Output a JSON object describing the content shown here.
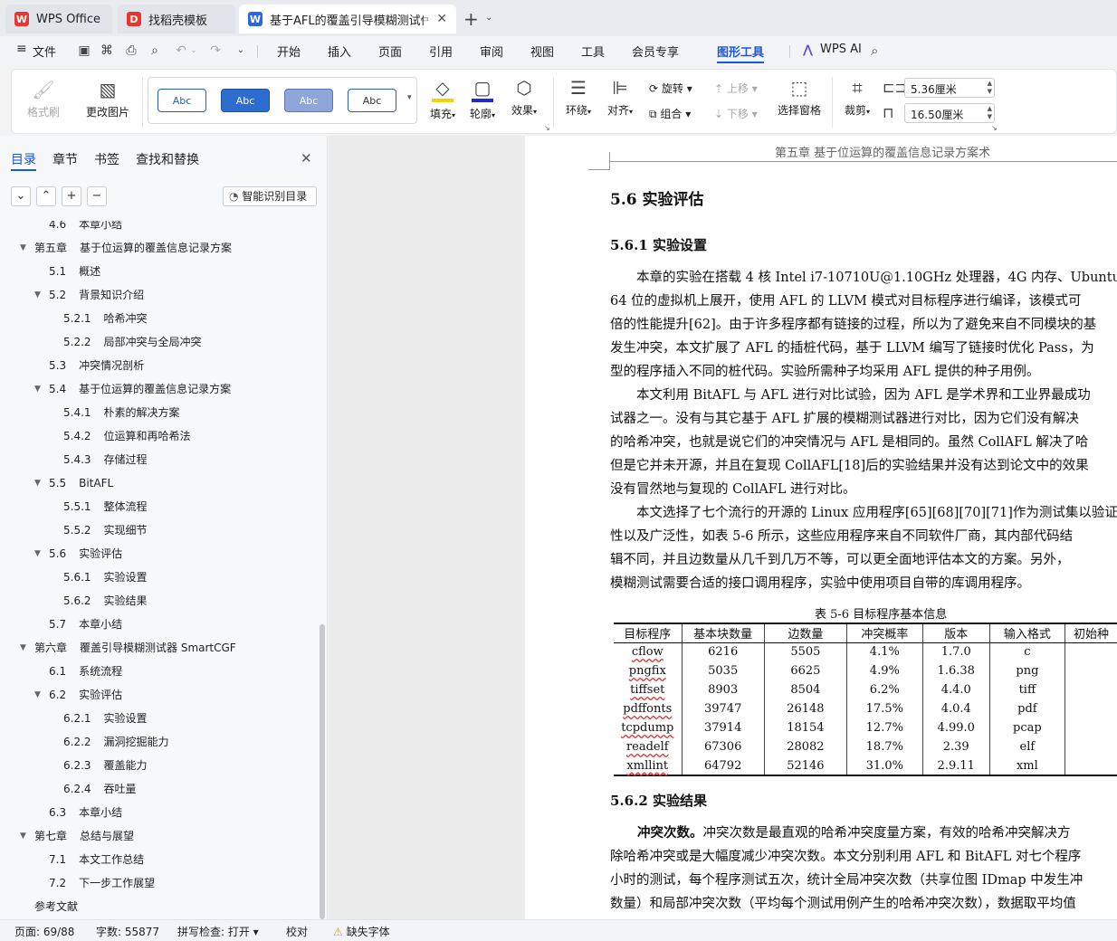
{
  "tabs": [
    {
      "label": "WPS Office",
      "icon": "wps-logo-icon",
      "color": "#e8352e"
    },
    {
      "label": "找稻壳模板",
      "icon": "docer-logo-icon",
      "color": "#e8352e"
    },
    {
      "label": "基于AFL的覆盖引导模糊测试优",
      "icon": "word-doc-icon",
      "color": "#2d64e8"
    }
  ],
  "menu": {
    "file": "文件",
    "items": [
      "开始",
      "插入",
      "页面",
      "引用",
      "审阅",
      "视图",
      "工具",
      "会员专享",
      "图形工具"
    ],
    "active": "图形工具",
    "ai": "WPS AI"
  },
  "ribbon": {
    "format_painter": "格式刷",
    "change_image": "更改图片",
    "style_samples": [
      "Abc",
      "Abc",
      "Abc",
      "Abc"
    ],
    "fill": "填充",
    "outline": "轮廓",
    "effect": "效果",
    "wrap": "环绕",
    "align": "对齐",
    "rotate": "旋转",
    "group": "组合",
    "bring_forward": "上移",
    "send_backward": "下移",
    "selection_pane": "选择窗格",
    "crop": "裁剪",
    "width": "5.36厘米",
    "height": "16.50厘米",
    "accent": "#1a56d9"
  },
  "nav": {
    "tabs": [
      "目录",
      "章节",
      "书签",
      "查找和替换"
    ],
    "smart_toc": "智能识别目录",
    "toc": [
      {
        "num": "4.6",
        "title": "本章小结",
        "level": 2,
        "toggle": ""
      },
      {
        "num": "第五章",
        "title": "基于位运算的覆盖信息记录方案",
        "level": 1,
        "toggle": "▼"
      },
      {
        "num": "5.1",
        "title": "概述",
        "level": 2,
        "toggle": ""
      },
      {
        "num": "5.2",
        "title": "背景知识介绍",
        "level": 2,
        "toggle": "▼"
      },
      {
        "num": "5.2.1",
        "title": "哈希冲突",
        "level": 3,
        "toggle": ""
      },
      {
        "num": "5.2.2",
        "title": "局部冲突与全局冲突",
        "level": 3,
        "toggle": ""
      },
      {
        "num": "5.3",
        "title": "冲突情况剖析",
        "level": 2,
        "toggle": ""
      },
      {
        "num": "5.4",
        "title": "基于位运算的覆盖信息记录方案",
        "level": 2,
        "toggle": "▼"
      },
      {
        "num": "5.4.1",
        "title": "朴素的解决方案",
        "level": 3,
        "toggle": ""
      },
      {
        "num": "5.4.2",
        "title": "位运算和再哈希法",
        "level": 3,
        "toggle": ""
      },
      {
        "num": "5.4.3",
        "title": "存储过程",
        "level": 3,
        "toggle": ""
      },
      {
        "num": "5.5",
        "title": "BitAFL",
        "level": 2,
        "toggle": "▼"
      },
      {
        "num": "5.5.1",
        "title": "整体流程",
        "level": 3,
        "toggle": ""
      },
      {
        "num": "5.5.2",
        "title": "实现细节",
        "level": 3,
        "toggle": ""
      },
      {
        "num": "5.6",
        "title": "实验评估",
        "level": 2,
        "toggle": "▼"
      },
      {
        "num": "5.6.1",
        "title": "实验设置",
        "level": 3,
        "toggle": ""
      },
      {
        "num": "5.6.2",
        "title": "实验结果",
        "level": 3,
        "toggle": ""
      },
      {
        "num": "5.7",
        "title": "本章小结",
        "level": 2,
        "toggle": ""
      },
      {
        "num": "第六章",
        "title": "覆盖引导模糊测试器 SmartCGF",
        "level": 1,
        "toggle": "▼"
      },
      {
        "num": "6.1",
        "title": "系统流程",
        "level": 2,
        "toggle": ""
      },
      {
        "num": "6.2",
        "title": "实验评估",
        "level": 2,
        "toggle": "▼"
      },
      {
        "num": "6.2.1",
        "title": "实验设置",
        "level": 3,
        "toggle": ""
      },
      {
        "num": "6.2.2",
        "title": "漏洞挖掘能力",
        "level": 3,
        "toggle": ""
      },
      {
        "num": "6.2.3",
        "title": "覆盖能力",
        "level": 3,
        "toggle": ""
      },
      {
        "num": "6.2.4",
        "title": "吞吐量",
        "level": 3,
        "toggle": ""
      },
      {
        "num": "6.3",
        "title": "本章小结",
        "level": 2,
        "toggle": ""
      },
      {
        "num": "第七章",
        "title": "总结与展望",
        "level": 1,
        "toggle": "▼"
      },
      {
        "num": "7.1",
        "title": "本文工作总结",
        "level": 2,
        "toggle": ""
      },
      {
        "num": "7.2",
        "title": "下一步工作展望",
        "level": 2,
        "toggle": ""
      },
      {
        "num": "",
        "title": "参考文献",
        "level": 1,
        "toggle": ""
      }
    ]
  },
  "doc": {
    "running_header": "第五章  基于位运算的覆盖信息记录方案术",
    "h1": "5.6   实验评估",
    "h2a": "5.6.1   实验设置",
    "h2b": "5.6.2   实验结果",
    "lines": [
      "　　本章的实验在搭载 4 核 Intel i7-10710U@1.10GHz 处理器，4G 内存、Ubuntu",
      "64 位的虚拟机上展开，使用 AFL 的 LLVM 模式对目标程序进行编译，该模式可",
      "倍的性能提升[62]。由于许多程序都有链接的过程，所以为了避免来自不同模块的基",
      "发生冲突，本文扩展了 AFL 的插桩代码，基于 LLVM 编写了链接时优化 Pass，为",
      "型的程序插入不同的桩代码。实验所需种子均采用 AFL 提供的种子用例。",
      "　　本文利用 BitAFL 与 AFL 进行对比试验，因为 AFL 是学术界和工业界最成功",
      "试器之一。没有与其它基于 AFL 扩展的模糊测试器进行对比，因为它们没有解决",
      "的哈希冲突，也就是说它们的冲突情况与 AFL 是相同的。虽然 CollAFL 解决了哈",
      "但是它并未开源，并且在复现 CollAFL[18]后的实验结果并没有达到论文中的效果",
      "没有冒然地与复现的 CollAFL 进行对比。",
      "　　本文选择了七个流行的开源的 Linux 应用程序[65][68][70][71]作为测试集以验证方",
      "性以及广泛性，如表 5-6 所示，这些应用程序来自不同软件厂商，其内部代码结",
      "辑不同，并且边数量从几千到几万不等，可以更全面地评估本文的方案。另外，",
      "模糊测试需要合适的接口调用程序，实验中使用项目自带的库调用程序。"
    ],
    "table_caption": "表  5-6    目标程序基本信息",
    "table_headers": [
      "目标程序",
      "基本块数量",
      "边数量",
      "冲突概率",
      "版本",
      "输入格式",
      "初始种"
    ],
    "table_rows": [
      [
        "cflow",
        "6216",
        "5505",
        "4.1%",
        "1.7.0",
        "c",
        ""
      ],
      [
        "pngfix",
        "5035",
        "6625",
        "4.9%",
        "1.6.38",
        "png",
        ""
      ],
      [
        "tiffset",
        "8903",
        "8504",
        "6.2%",
        "4.4.0",
        "tiff",
        ""
      ],
      [
        "pdffonts",
        "39747",
        "26148",
        "17.5%",
        "4.0.4",
        "pdf",
        ""
      ],
      [
        "tcpdump",
        "37914",
        "18154",
        "12.7%",
        "4.99.0",
        "pcap",
        ""
      ],
      [
        "readelf",
        "67306",
        "28082",
        "18.7%",
        "2.39",
        "elf",
        ""
      ],
      [
        "xmllint",
        "64792",
        "52146",
        "31.0%",
        "2.9.11",
        "xml",
        ""
      ]
    ],
    "result_lead": "冲突次数。",
    "result_lines": [
      "冲突次数是最直观的哈希冲突度量方案，有效的哈希冲突解决方",
      "除哈希冲突或是大幅度减少冲突次数。本文分别利用 AFL 和 BitAFL 对七个程序",
      "小时的测试，每个程序测试五次，统计全局冲突次数（共享位图 IDmap 中发生冲",
      "数量）和局部冲突次数（平均每个测试用例产生的哈希冲突次数），数据取平均值"
    ]
  },
  "status": {
    "page": "页面: 69/88",
    "words": "字数: 55877",
    "spell": "拼写检查: 打开",
    "proof": "校对",
    "missing_font": "缺失字体"
  }
}
